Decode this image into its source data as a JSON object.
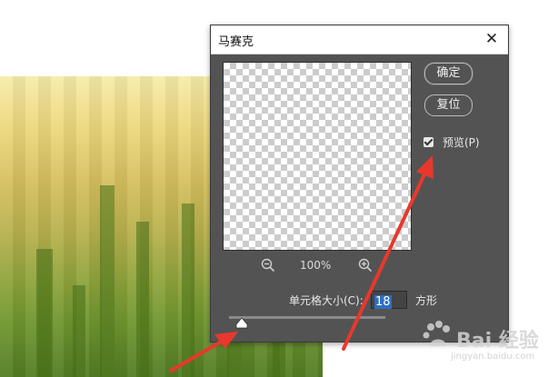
{
  "dialog": {
    "title": "马赛克",
    "close_symbol": "✕",
    "ok_label": "确定",
    "reset_label": "复位",
    "preview_checkbox": {
      "label": "预览(P)",
      "checked": true
    },
    "zoom_level": "100%",
    "cell_size": {
      "label": "单元格大小(C):",
      "value": "18",
      "unit": "方形"
    },
    "slider_level_fraction": 0.08
  },
  "icons": [
    "close-icon",
    "zoom-out-icon",
    "zoom-in-icon",
    "checkbox-check-icon",
    "slider-thumb-icon"
  ],
  "colors": {
    "dialog_bg": "#535353",
    "annotation_arrow": "#e8382e",
    "selection_highlight": "#2d6fbf"
  },
  "watermark": {
    "text": "Bai 经验",
    "url": "jingyan.baidu.com"
  }
}
